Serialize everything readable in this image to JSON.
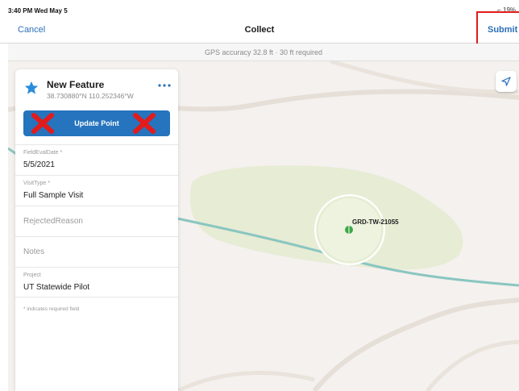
{
  "status_bar": {
    "time_date": "3:40 PM  Wed May 5",
    "right_status": "⌐ 19%"
  },
  "nav": {
    "cancel_label": "Cancel",
    "title": "Collect",
    "submit_label": "Submit"
  },
  "gps_bar": {
    "text": "GPS accuracy 32.8 ft  ·  30 ft required"
  },
  "feature_panel": {
    "title": "New Feature",
    "coordinates": "38.730880°N  110.252346°W",
    "icon": "star-icon",
    "more_icon": "ellipsis-icon",
    "update_button_label": "Update Point",
    "fields": [
      {
        "label": "FieldEvalDate *",
        "value": "5/5/2021"
      },
      {
        "label": "VisitType *",
        "value": "Full Sample Visit"
      },
      {
        "label": "",
        "placeholder": "RejectedReason"
      },
      {
        "label": "",
        "placeholder": "Notes"
      },
      {
        "label": "Project",
        "value": "UT Statewide Pilot"
      }
    ],
    "required_note": "* indicates required field"
  },
  "map": {
    "point_label": "GRD-TW-21055",
    "locate_icon": "location-arrow-icon"
  },
  "colors": {
    "accent": "#2a6fb8",
    "button": "#2574bd",
    "highlight": "#e21b1b",
    "point": "#3aa845"
  }
}
